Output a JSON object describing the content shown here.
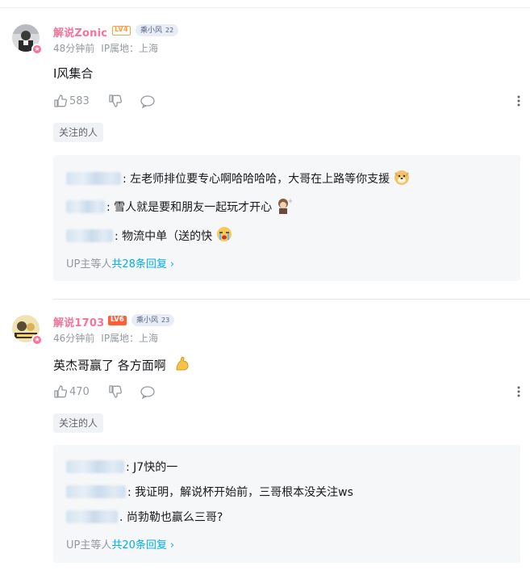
{
  "comments": [
    {
      "username": "解说Zonic",
      "level": "LV4",
      "fan_badge": "乘小风",
      "fan_level": "22",
      "time": "48分钟前",
      "ip": "IP属地：上海",
      "content": "I风集合",
      "likes": "583",
      "tag": "关注的人",
      "replies": [
        {
          "text": ": 左老师排位要专心啊哈哈哈哈，大哥在上路等你支援",
          "emoji": "doge-icon"
        },
        {
          "text": ": 雪人就是要和朋友一起玩才开心",
          "emoji": "character-sticker-icon"
        },
        {
          "text": ": 物流中单（送的快",
          "emoji": "crying-face-icon"
        }
      ],
      "more_prefix": "UP主等人",
      "more_count": "共28条回复",
      "more_chevron": "›"
    },
    {
      "username": "解说1703",
      "level": "LV6",
      "fan_badge": "乘小风",
      "fan_level": "23",
      "time": "46分钟前",
      "ip": "IP属地：上海",
      "content": "英杰哥赢了 各方面啊",
      "likes": "470",
      "tag": "关注的人",
      "replies": [
        {
          "text": ": J7快的一"
        },
        {
          "text": ": 我证明，解说杯开始前，三哥根本没关注ws"
        },
        {
          "text": ". 尚勃勒也赢么三哥?"
        }
      ],
      "more_prefix": "UP主等人",
      "more_count": "共20条回复",
      "more_chevron": "›"
    }
  ],
  "colors": {
    "username": "#fb7299",
    "link": "#00aeec",
    "muted": "#9499a0",
    "reply_bg": "#f6f7f8"
  }
}
